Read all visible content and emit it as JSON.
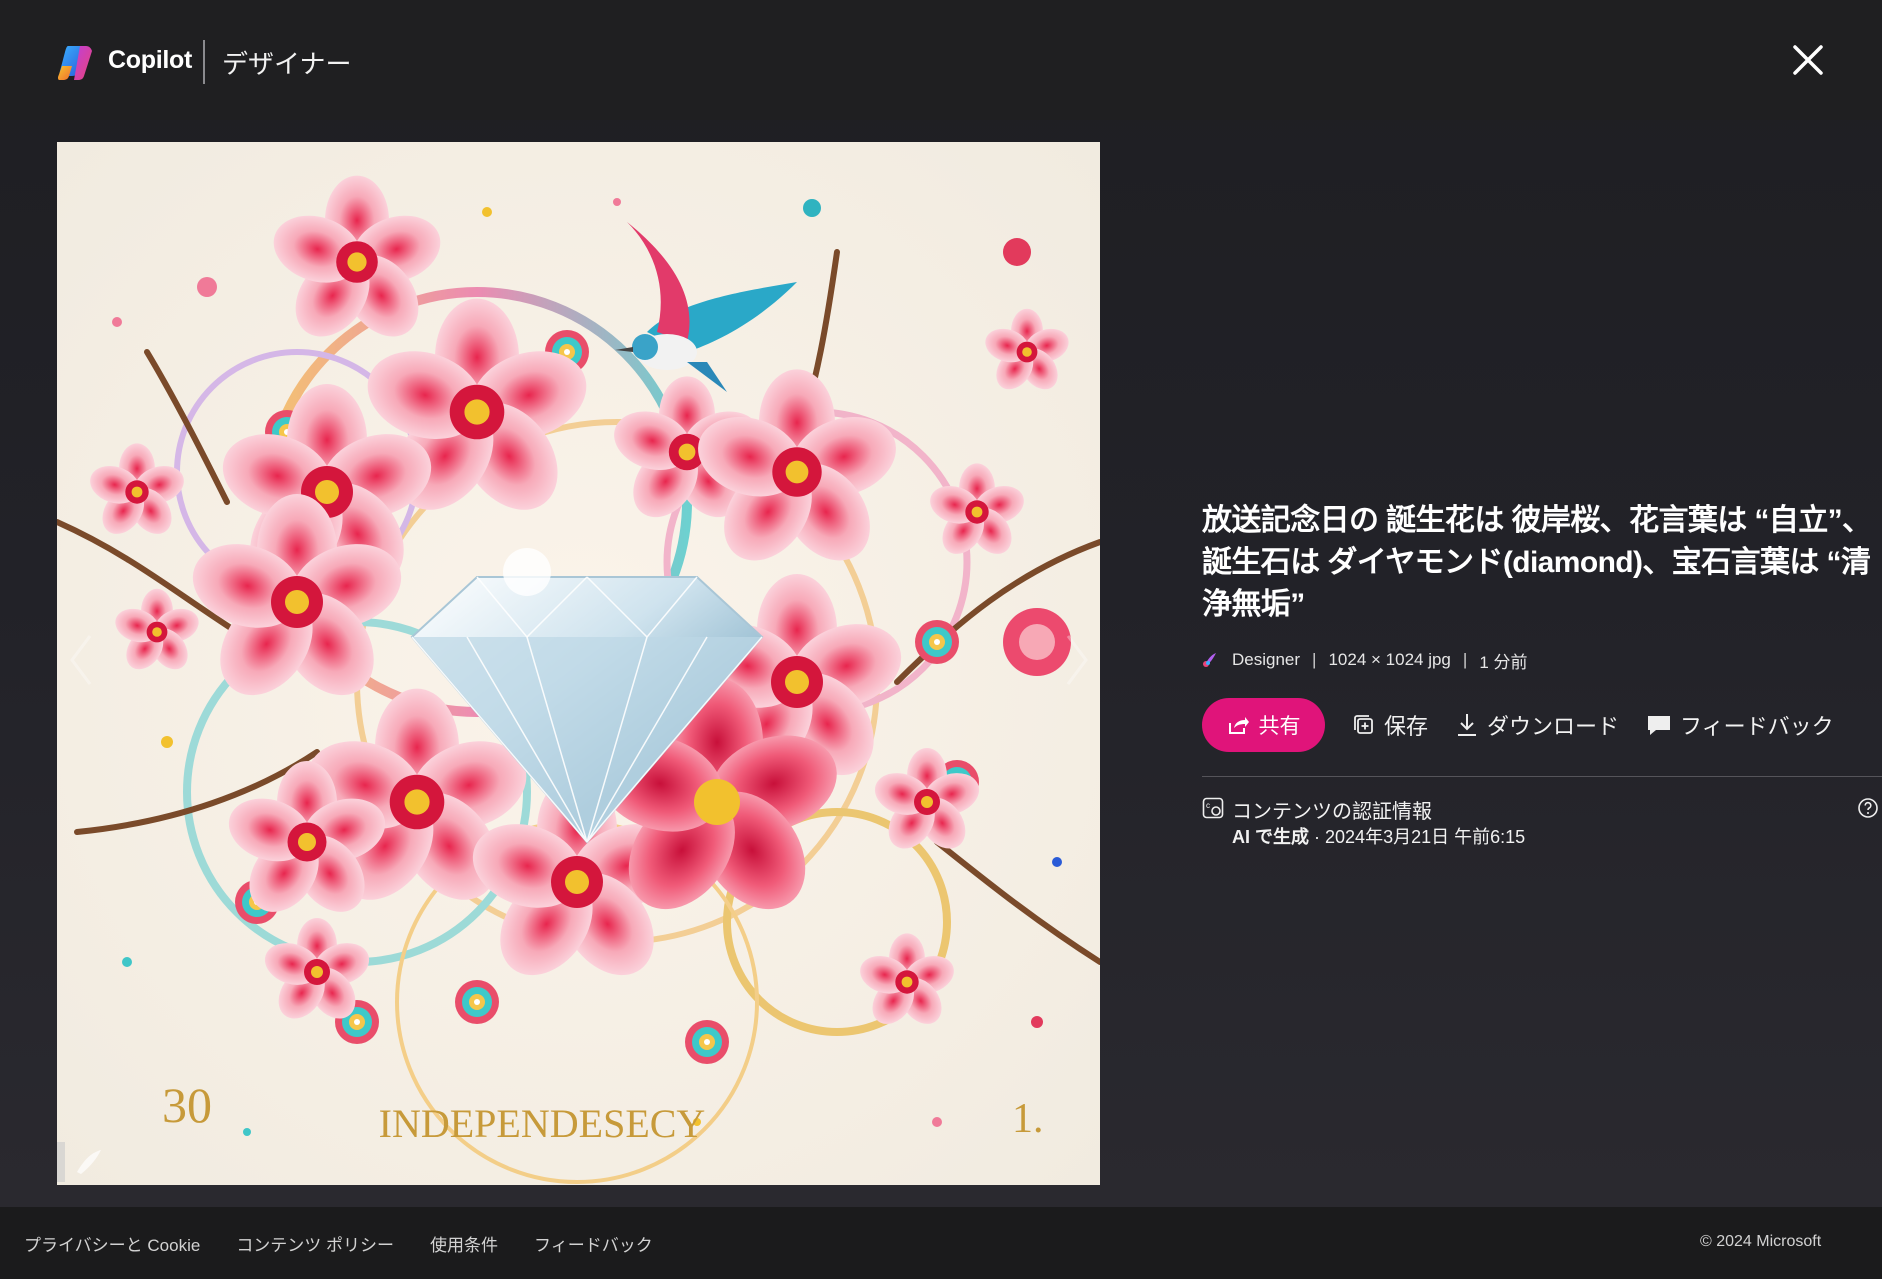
{
  "header": {
    "brand": "Copilot",
    "product": "デザイナー",
    "logo_icon": "copilot-logo-icon",
    "close_icon": "close-icon"
  },
  "image": {
    "text_main": "INDEPENDESECY",
    "text_left": "30",
    "text_right": "1."
  },
  "details": {
    "title": "放送記念日の 誕生花は 彼岸桜、花言葉は “自立”、誕生石は ダイヤモンド(diamond)、宝石言葉は “清浄無垢”",
    "meta": {
      "source": "Designer",
      "size": "1024 × 1024 jpg",
      "time": "1 分前"
    },
    "actions": {
      "share": "共有",
      "save": "保存",
      "download": "ダウンロード",
      "feedback": "フィードバック"
    },
    "credentials": {
      "title": "コンテンツの認証情報",
      "ai_label": "AI で生成",
      "date": "· 2024年3月21日 午前6:15"
    }
  },
  "footer": {
    "links": [
      "プライバシーと Cookie",
      "コンテンツ ポリシー",
      "使用条件",
      "フィードバック"
    ],
    "copyright": "© 2024 Microsoft"
  },
  "colors": {
    "accent": "#e0147a",
    "background": "#1f1f21"
  }
}
